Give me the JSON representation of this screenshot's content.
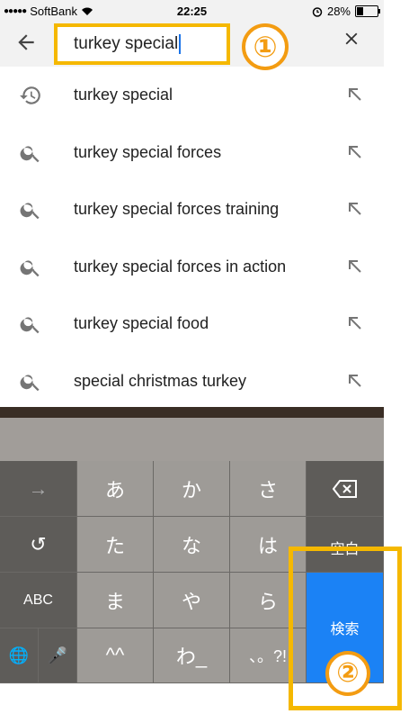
{
  "status_bar": {
    "signal_dots": "●●●●●",
    "carrier": "SoftBank",
    "time": "22:25",
    "battery_percent": "28%",
    "battery_level": 0.28
  },
  "search": {
    "query": "turkey special",
    "badge": "①"
  },
  "suggestions": [
    {
      "label": "turkey special",
      "icon": "history-icon"
    },
    {
      "label": "turkey special forces",
      "icon": "search-icon"
    },
    {
      "label": "turkey special forces training",
      "icon": "search-icon"
    },
    {
      "label": "turkey special forces in action",
      "icon": "search-icon"
    },
    {
      "label": "turkey special food",
      "icon": "search-icon"
    },
    {
      "label": "special christmas turkey",
      "icon": "search-icon"
    }
  ],
  "keyboard": {
    "row1": [
      "→",
      "あ",
      "か",
      "さ",
      "⌫"
    ],
    "row2": [
      "↺",
      "た",
      "な",
      "は",
      "空白"
    ],
    "row3": [
      "ABC",
      "ま",
      "や",
      "ら"
    ],
    "row4": [
      "🌐",
      "🎤",
      "^^",
      "わ_",
      "、。?!"
    ],
    "search_key": "検索",
    "badge": "②"
  },
  "colors": {
    "highlight": "#f5b800",
    "badge": "#f39c12",
    "search_key": "#1b82f5"
  }
}
